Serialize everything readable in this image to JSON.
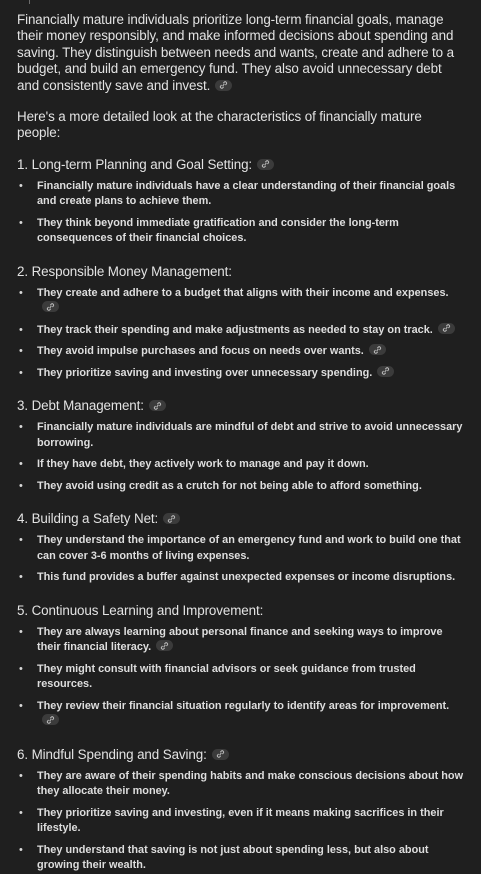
{
  "intro": "Financially mature individuals prioritize long-term financial goals, manage their money responsibly, and make informed decisions about spending and saving. They distinguish between needs and wants, create and adhere to a budget, and build an emergency fund. They also avoid unnecessary debt and consistently save and invest.",
  "lead": "Here's a more detailed look at the characteristics of financially mature people:",
  "link_icon": "link-icon",
  "sections": [
    {
      "heading": "1. Long-term Planning and Goal Setting:",
      "items": [
        "Financially mature individuals have a clear understanding of their financial goals and create plans to achieve them.",
        "They think beyond immediate gratification and consider the long-term consequences of their financial choices."
      ]
    },
    {
      "heading": "2. Responsible Money Management:",
      "items": [
        "They create and adhere to a budget that aligns with their income and expenses.",
        "They track their spending and make adjustments as needed to stay on track.",
        "They avoid impulse purchases and focus on needs over wants.",
        "They prioritize saving and investing over unnecessary spending."
      ]
    },
    {
      "heading": "3. Debt Management:",
      "items": [
        "Financially mature individuals are mindful of debt and strive to avoid unnecessary borrowing.",
        "If they have debt, they actively work to manage and pay it down.",
        "They avoid using credit as a crutch for not being able to afford something."
      ]
    },
    {
      "heading": "4. Building a Safety Net:",
      "items": [
        "They understand the importance of an emergency fund and work to build one that can cover 3-6 months of living expenses.",
        "This fund provides a buffer against unexpected expenses or income disruptions."
      ]
    },
    {
      "heading": "5. Continuous Learning and Improvement:",
      "items": [
        "They are always learning about personal finance and seeking ways to improve their financial literacy.",
        "They might consult with financial advisors or seek guidance from trusted resources.",
        "They review their financial situation regularly to identify areas for improvement."
      ]
    },
    {
      "heading": "6. Mindful Spending and Saving:",
      "items": [
        "They are aware of their spending habits and make conscious decisions about how they allocate their money.",
        "They prioritize saving and investing, even if it means making sacrifices in their lifestyle.",
        "They understand that saving is not just about spending less, but also about growing their wealth."
      ]
    }
  ]
}
